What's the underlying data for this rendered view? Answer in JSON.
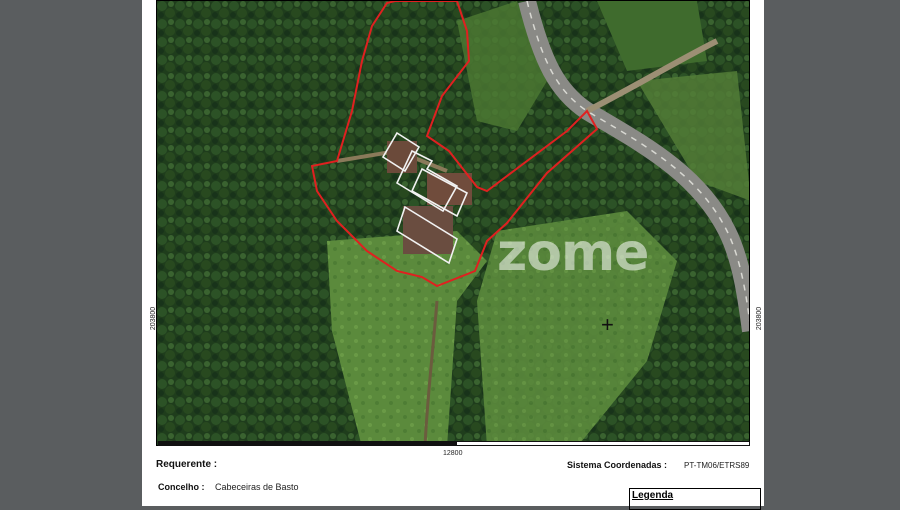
{
  "map": {
    "coord_left": "203800",
    "coord_right": "203800",
    "coord_bottom": "12800",
    "watermark": "zome",
    "crosshair_icon": "crosshair-icon",
    "boundary_color": "#e02020",
    "building_outline_color": "#f2f2f2"
  },
  "info": {
    "requerente_label": "Requerente :",
    "requerente_value": "",
    "concelho_label": "Concelho :",
    "concelho_value": "Cabeceiras de Basto",
    "sistema_label": "Sistema Coordenadas :",
    "sistema_value": "PT-TM06/ETRS89"
  },
  "legend": {
    "title": "Legenda"
  }
}
